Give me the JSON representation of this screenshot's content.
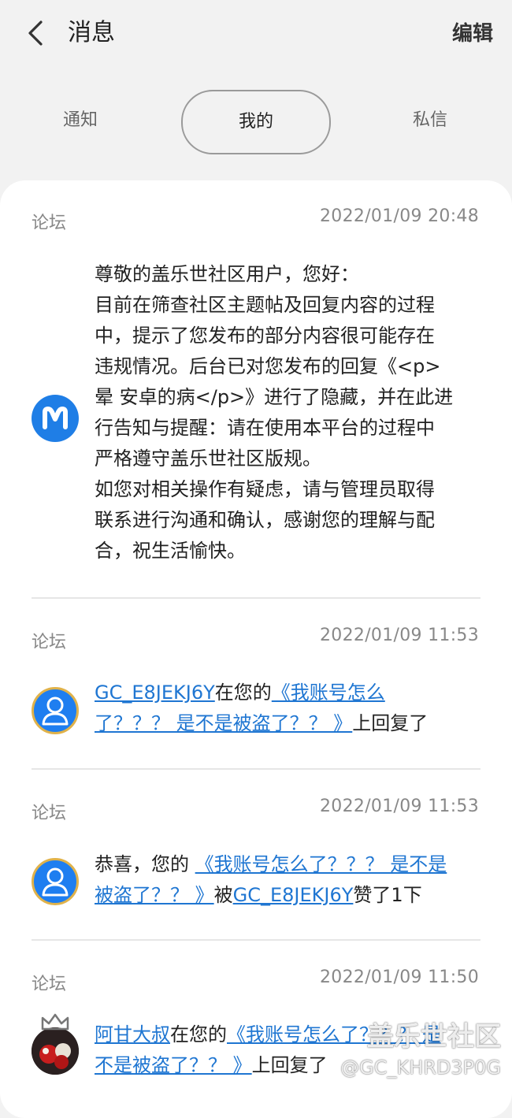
{
  "header": {
    "title": "消息",
    "edit_label": "编辑"
  },
  "tabs": [
    {
      "label": "通知"
    },
    {
      "label": "我的",
      "selected": true
    },
    {
      "label": "私信"
    }
  ],
  "messages": [
    {
      "source": "论坛",
      "time": "2022/01/09 20:48",
      "avatar": "m-logo-icon",
      "lines": [
        "尊敬的盖乐世社区用户，您好：",
        "目前在筛查社区主题帖及回复内容的过程",
        "中，提示了您发布的部分内容很可能存在",
        "违规情况。后台已对您发布的回复《<p>",
        "晕 安卓的病</p>》进行了隐藏，并在此进",
        "行告知与提醒：请在使用本平台的过程中",
        "严格遵守盖乐世社区版规。",
        "如您对相关操作有疑虑，请与管理员取得",
        "联系进行沟通和确认，感谢您的理解与配",
        "合，祝生活愉快。"
      ]
    },
    {
      "source": "论坛",
      "time": "2022/01/09 11:53",
      "avatar": "user-icon",
      "user": "GC_E8JEKJ6Y",
      "mid": "在您的",
      "link_line1": "《我账号怎么",
      "link_line2": "了？？？ 是不是被盗了？？ 》",
      "suffix": "上回复了"
    },
    {
      "source": "论坛",
      "time": "2022/01/09 11:53",
      "avatar": "user-icon",
      "prefix": "恭喜，您的 ",
      "link_line1": "《我账号怎么了？？？ 是不是",
      "link_line2": "被盗了？？ 》",
      "mid": "被",
      "user": "GC_E8JEKJ6Y",
      "suffix": "赞了1下"
    },
    {
      "source": "论坛",
      "time": "2022/01/09 11:50",
      "avatar": "photo-avatar",
      "user": "阿甘大叔",
      "mid": "在您的",
      "link_line1": "《我账号怎么了？？？ 是",
      "link_line2": "不是被盗了？？ 》",
      "suffix": "上回复了"
    }
  ],
  "watermark": {
    "brand": "盖乐世社区",
    "user": "@GC_KHRD3P0G"
  }
}
